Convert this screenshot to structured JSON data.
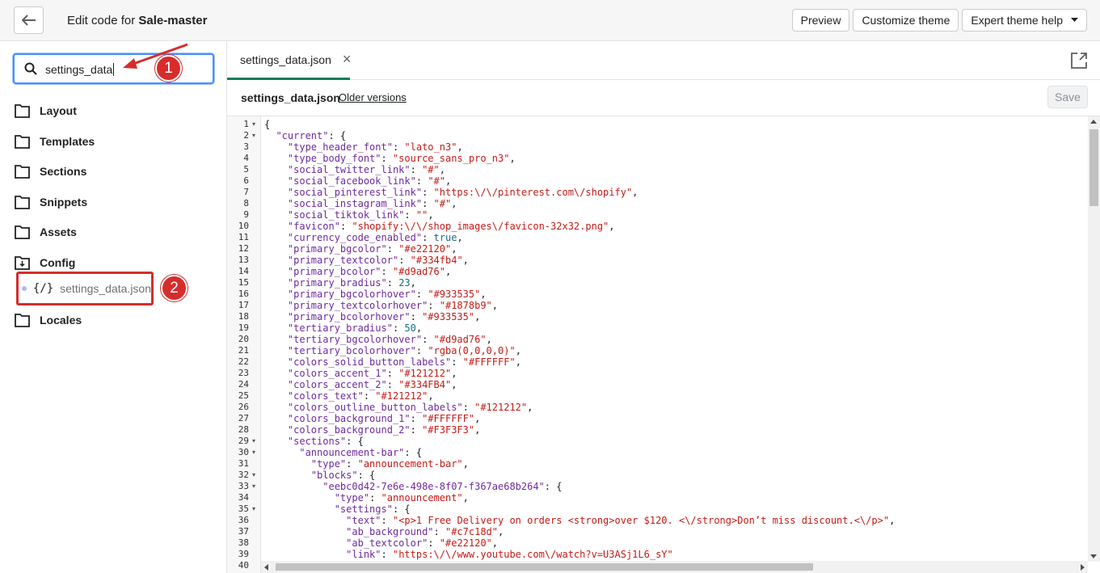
{
  "header": {
    "title_prefix": "Edit code for ",
    "title_theme": "Sale-master",
    "preview_label": "Preview",
    "customize_label": "Customize theme",
    "expert_label": "Expert theme help"
  },
  "search": {
    "value": "settings_data"
  },
  "sidebar": {
    "folders": [
      "Layout",
      "Templates",
      "Sections",
      "Snippets",
      "Assets",
      "Config",
      "Locales"
    ],
    "file": {
      "icon_glyph": "{/}",
      "name": "settings_data.json"
    }
  },
  "badges": {
    "one": "1",
    "two": "2"
  },
  "tab": {
    "name": "settings_data.json",
    "close_glyph": "×"
  },
  "file_header": {
    "name": "settings_data.json",
    "older_versions": "Older versions",
    "save_label": "Save"
  },
  "editor": {
    "line_numbers": [
      "1",
      "2",
      "3",
      "4",
      "5",
      "6",
      "7",
      "8",
      "9",
      "10",
      "11",
      "12",
      "13",
      "14",
      "15",
      "16",
      "17",
      "18",
      "19",
      "20",
      "21",
      "22",
      "23",
      "24",
      "25",
      "26",
      "27",
      "28",
      "29",
      "30",
      "31",
      "32",
      "33",
      "34",
      "35",
      "36",
      "37",
      "38",
      "39",
      "40"
    ],
    "fold_lines": [
      1,
      2,
      29,
      30,
      32,
      33,
      35
    ],
    "lines": [
      [
        [
          "p",
          "{"
        ]
      ],
      [
        [
          "p",
          "  "
        ],
        [
          "k",
          "\"current\""
        ],
        [
          "p",
          ": {"
        ]
      ],
      [
        [
          "p",
          "    "
        ],
        [
          "k",
          "\"type_header_font\""
        ],
        [
          "p",
          ": "
        ],
        [
          "s",
          "\"lato_n3\""
        ],
        [
          "p",
          ","
        ]
      ],
      [
        [
          "p",
          "    "
        ],
        [
          "k",
          "\"type_body_font\""
        ],
        [
          "p",
          ": "
        ],
        [
          "s",
          "\"source_sans_pro_n3\""
        ],
        [
          "p",
          ","
        ]
      ],
      [
        [
          "p",
          "    "
        ],
        [
          "k",
          "\"social_twitter_link\""
        ],
        [
          "p",
          ": "
        ],
        [
          "s",
          "\"#\""
        ],
        [
          "p",
          ","
        ]
      ],
      [
        [
          "p",
          "    "
        ],
        [
          "k",
          "\"social_facebook_link\""
        ],
        [
          "p",
          ": "
        ],
        [
          "s",
          "\"#\""
        ],
        [
          "p",
          ","
        ]
      ],
      [
        [
          "p",
          "    "
        ],
        [
          "k",
          "\"social_pinterest_link\""
        ],
        [
          "p",
          ": "
        ],
        [
          "s",
          "\"https:\\/\\/pinterest.com\\/shopify\""
        ],
        [
          "p",
          ","
        ]
      ],
      [
        [
          "p",
          "    "
        ],
        [
          "k",
          "\"social_instagram_link\""
        ],
        [
          "p",
          ": "
        ],
        [
          "s",
          "\"#\""
        ],
        [
          "p",
          ","
        ]
      ],
      [
        [
          "p",
          "    "
        ],
        [
          "k",
          "\"social_tiktok_link\""
        ],
        [
          "p",
          ": "
        ],
        [
          "s",
          "\"\""
        ],
        [
          "p",
          ","
        ]
      ],
      [
        [
          "p",
          "    "
        ],
        [
          "k",
          "\"favicon\""
        ],
        [
          "p",
          ": "
        ],
        [
          "s",
          "\"shopify:\\/\\/shop_images\\/favicon-32x32.png\""
        ],
        [
          "p",
          ","
        ]
      ],
      [
        [
          "p",
          "    "
        ],
        [
          "k",
          "\"currency_code_enabled\""
        ],
        [
          "p",
          ": "
        ],
        [
          "n",
          "true"
        ],
        [
          "p",
          ","
        ]
      ],
      [
        [
          "p",
          "    "
        ],
        [
          "k",
          "\"primary_bgcolor\""
        ],
        [
          "p",
          ": "
        ],
        [
          "s",
          "\"#e22120\""
        ],
        [
          "p",
          ","
        ]
      ],
      [
        [
          "p",
          "    "
        ],
        [
          "k",
          "\"primary_textcolor\""
        ],
        [
          "p",
          ": "
        ],
        [
          "s",
          "\"#334fb4\""
        ],
        [
          "p",
          ","
        ]
      ],
      [
        [
          "p",
          "    "
        ],
        [
          "k",
          "\"primary_bcolor\""
        ],
        [
          "p",
          ": "
        ],
        [
          "s",
          "\"#d9ad76\""
        ],
        [
          "p",
          ","
        ]
      ],
      [
        [
          "p",
          "    "
        ],
        [
          "k",
          "\"primary_bradius\""
        ],
        [
          "p",
          ": "
        ],
        [
          "n",
          "23"
        ],
        [
          "p",
          ","
        ]
      ],
      [
        [
          "p",
          "    "
        ],
        [
          "k",
          "\"primary_bgcolorhover\""
        ],
        [
          "p",
          ": "
        ],
        [
          "s",
          "\"#933535\""
        ],
        [
          "p",
          ","
        ]
      ],
      [
        [
          "p",
          "    "
        ],
        [
          "k",
          "\"primary_textcolorhover\""
        ],
        [
          "p",
          ": "
        ],
        [
          "s",
          "\"#1878b9\""
        ],
        [
          "p",
          ","
        ]
      ],
      [
        [
          "p",
          "    "
        ],
        [
          "k",
          "\"primary_bcolorhover\""
        ],
        [
          "p",
          ": "
        ],
        [
          "s",
          "\"#933535\""
        ],
        [
          "p",
          ","
        ]
      ],
      [
        [
          "p",
          "    "
        ],
        [
          "k",
          "\"tertiary_bradius\""
        ],
        [
          "p",
          ": "
        ],
        [
          "n",
          "50"
        ],
        [
          "p",
          ","
        ]
      ],
      [
        [
          "p",
          "    "
        ],
        [
          "k",
          "\"tertiary_bgcolorhover\""
        ],
        [
          "p",
          ": "
        ],
        [
          "s",
          "\"#d9ad76\""
        ],
        [
          "p",
          ","
        ]
      ],
      [
        [
          "p",
          "    "
        ],
        [
          "k",
          "\"tertiary_bcolorhover\""
        ],
        [
          "p",
          ": "
        ],
        [
          "s",
          "\"rgba(0,0,0,0)\""
        ],
        [
          "p",
          ","
        ]
      ],
      [
        [
          "p",
          "    "
        ],
        [
          "k",
          "\"colors_solid_button_labels\""
        ],
        [
          "p",
          ": "
        ],
        [
          "s",
          "\"#FFFFFF\""
        ],
        [
          "p",
          ","
        ]
      ],
      [
        [
          "p",
          "    "
        ],
        [
          "k",
          "\"colors_accent_1\""
        ],
        [
          "p",
          ": "
        ],
        [
          "s",
          "\"#121212\""
        ],
        [
          "p",
          ","
        ]
      ],
      [
        [
          "p",
          "    "
        ],
        [
          "k",
          "\"colors_accent_2\""
        ],
        [
          "p",
          ": "
        ],
        [
          "s",
          "\"#334FB4\""
        ],
        [
          "p",
          ","
        ]
      ],
      [
        [
          "p",
          "    "
        ],
        [
          "k",
          "\"colors_text\""
        ],
        [
          "p",
          ": "
        ],
        [
          "s",
          "\"#121212\""
        ],
        [
          "p",
          ","
        ]
      ],
      [
        [
          "p",
          "    "
        ],
        [
          "k",
          "\"colors_outline_button_labels\""
        ],
        [
          "p",
          ": "
        ],
        [
          "s",
          "\"#121212\""
        ],
        [
          "p",
          ","
        ]
      ],
      [
        [
          "p",
          "    "
        ],
        [
          "k",
          "\"colors_background_1\""
        ],
        [
          "p",
          ": "
        ],
        [
          "s",
          "\"#FFFFFF\""
        ],
        [
          "p",
          ","
        ]
      ],
      [
        [
          "p",
          "    "
        ],
        [
          "k",
          "\"colors_background_2\""
        ],
        [
          "p",
          ": "
        ],
        [
          "s",
          "\"#F3F3F3\""
        ],
        [
          "p",
          ","
        ]
      ],
      [
        [
          "p",
          "    "
        ],
        [
          "k",
          "\"sections\""
        ],
        [
          "p",
          ": {"
        ]
      ],
      [
        [
          "p",
          "      "
        ],
        [
          "k",
          "\"announcement-bar\""
        ],
        [
          "p",
          ": {"
        ]
      ],
      [
        [
          "p",
          "        "
        ],
        [
          "k",
          "\"type\""
        ],
        [
          "p",
          ": "
        ],
        [
          "s",
          "\"announcement-bar\""
        ],
        [
          "p",
          ","
        ]
      ],
      [
        [
          "p",
          "        "
        ],
        [
          "k",
          "\"blocks\""
        ],
        [
          "p",
          ": {"
        ]
      ],
      [
        [
          "p",
          "          "
        ],
        [
          "k",
          "\"eebc0d42-7e6e-498e-8f07-f367ae68b264\""
        ],
        [
          "p",
          ": {"
        ]
      ],
      [
        [
          "p",
          "            "
        ],
        [
          "k",
          "\"type\""
        ],
        [
          "p",
          ": "
        ],
        [
          "s",
          "\"announcement\""
        ],
        [
          "p",
          ","
        ]
      ],
      [
        [
          "p",
          "            "
        ],
        [
          "k",
          "\"settings\""
        ],
        [
          "p",
          ": {"
        ]
      ],
      [
        [
          "p",
          "              "
        ],
        [
          "k",
          "\"text\""
        ],
        [
          "p",
          ": "
        ],
        [
          "s",
          "\"<p>1 Free Delivery on orders <strong>over $120. <\\/strong>Don’t miss discount.<\\/p>\""
        ],
        [
          "p",
          ","
        ]
      ],
      [
        [
          "p",
          "              "
        ],
        [
          "k",
          "\"ab_background\""
        ],
        [
          "p",
          ": "
        ],
        [
          "s",
          "\"#c7c18d\""
        ],
        [
          "p",
          ","
        ]
      ],
      [
        [
          "p",
          "              "
        ],
        [
          "k",
          "\"ab_textcolor\""
        ],
        [
          "p",
          ": "
        ],
        [
          "s",
          "\"#e22120\""
        ],
        [
          "p",
          ","
        ]
      ],
      [
        [
          "p",
          "              "
        ],
        [
          "k",
          "\"link\""
        ],
        [
          "p",
          ": "
        ],
        [
          "s",
          "\"https:\\/\\/www.youtube.com\\/watch?v=U3ASj1L6_sY\""
        ]
      ],
      [
        [
          "p",
          ""
        ]
      ]
    ]
  }
}
